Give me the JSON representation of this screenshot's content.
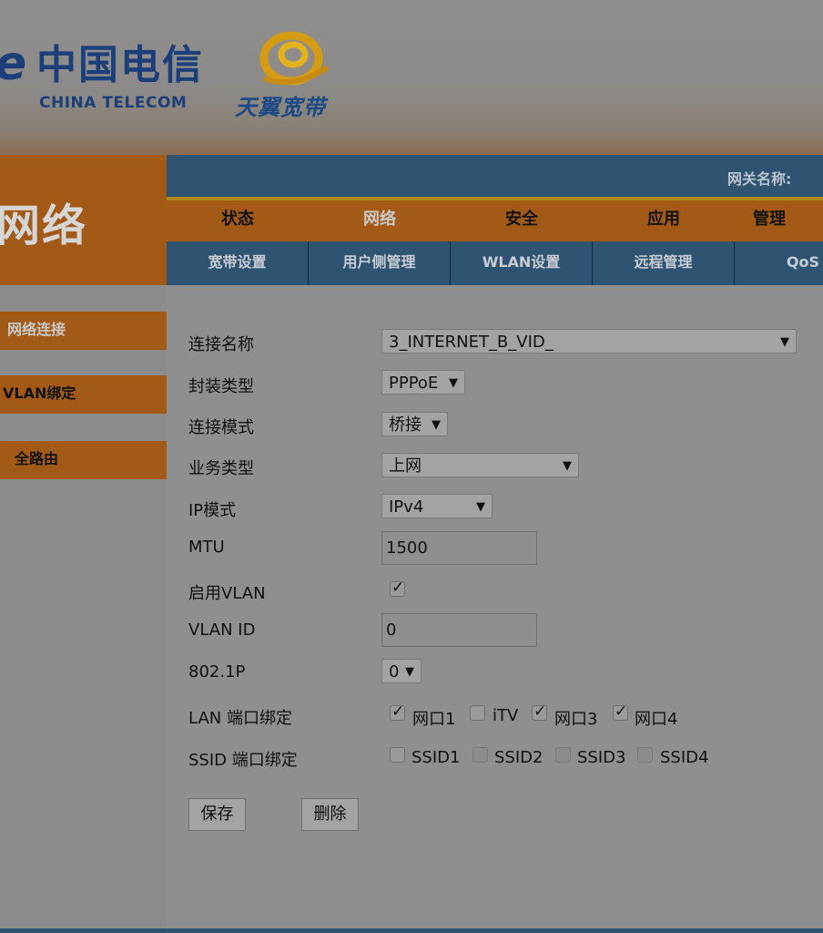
{
  "header": {
    "brand_glyph": "e",
    "brand_cn": "中国电信",
    "brand_en": "CHINA TELECOM",
    "product_name": "天翼宽带"
  },
  "section_title": "网络",
  "topbar": {
    "gateway_label": "网关名称:"
  },
  "main_nav": [
    "状态",
    "网络",
    "安全",
    "应用",
    "管理"
  ],
  "sub_nav": [
    "宽带设置",
    "用户侧管理",
    "WLAN设置",
    "远程管理",
    "QoS"
  ],
  "sidebar": [
    "网络连接",
    "VLAN绑定",
    "全路由"
  ],
  "form": {
    "connection_name_label": "连接名称",
    "connection_name_value": "3_INTERNET_B_VID_",
    "encap_label": "封装类型",
    "encap_value": "PPPoE",
    "conn_mode_label": "连接模式",
    "conn_mode_value": "桥接",
    "service_label": "业务类型",
    "service_value": "上网",
    "ip_mode_label": "IP模式",
    "ip_mode_value": "IPv4",
    "mtu_label": "MTU",
    "mtu_value": "1500",
    "vlan_enable_label": "启用VLAN",
    "vlan_id_label": "VLAN ID",
    "vlan_id_value": "0",
    "p8021_label": "802.1P",
    "p8021_value": "0",
    "lan_bind_label": "LAN 端口绑定",
    "lan_ports": [
      {
        "label": "网口1",
        "checked": true
      },
      {
        "label": "iTV",
        "checked": false
      },
      {
        "label": "网口3",
        "checked": true
      },
      {
        "label": "网口4",
        "checked": true
      }
    ],
    "ssid_bind_label": "SSID 端口绑定",
    "ssids": [
      {
        "label": "SSID1",
        "checked": false
      },
      {
        "label": "SSID2",
        "checked": false
      },
      {
        "label": "SSID3",
        "checked": false
      },
      {
        "label": "SSID4",
        "checked": false
      }
    ],
    "save_label": "保存",
    "delete_label": "删除"
  },
  "colors": {
    "accent_orange": "#a35a17",
    "nav_blue": "#2f5472",
    "brand_blue": "#1c3f7a"
  }
}
